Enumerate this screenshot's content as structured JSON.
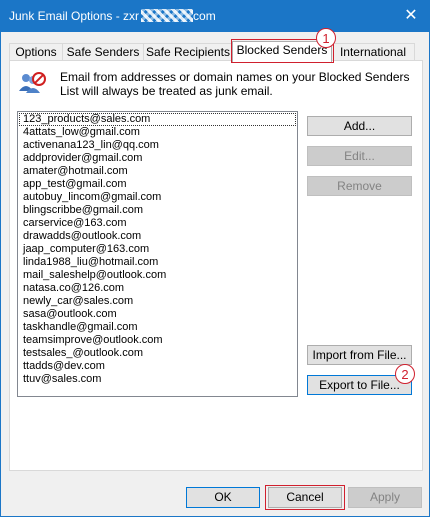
{
  "window": {
    "title_prefix": "Junk Email Options - zxr",
    "title_suffix": "com",
    "close_glyph": "✕"
  },
  "tabs": [
    {
      "label": "Options"
    },
    {
      "label": "Safe Senders"
    },
    {
      "label": "Safe Recipients"
    },
    {
      "label": "Blocked Senders"
    },
    {
      "label": "International"
    }
  ],
  "active_tab": "Blocked Senders",
  "annotations": [
    "1",
    "2"
  ],
  "info": {
    "icon": "blocked-senders-icon",
    "text": "Email from addresses or domain names on your Blocked Senders List will always be treated as junk email."
  },
  "senders": [
    "123_products@sales.com",
    "4attats_low@gmail.com",
    "activenana123_lin@qq.com",
    "addprovider@gmail.com",
    "amater@hotmail.com",
    "app_test@gmail.com",
    "autobuy_lincom@gmail.com",
    "blingscribbe@gmail.com",
    "carservice@163.com",
    "drawadds@outlook.com",
    "jaap_computer@163.com",
    "linda1988_liu@hotmail.com",
    "mail_saleshelp@outlook.com",
    "natasa.co@126.com",
    "newly_car@sales.com",
    "sasa@outlook.com",
    "taskhandle@gmail.com",
    "teamsimprove@outlook.com",
    "testsales_@outlook.com",
    "ttadds@dev.com",
    "ttuv@sales.com"
  ],
  "buttons": {
    "add": "Add...",
    "edit": "Edit...",
    "remove": "Remove",
    "import": "Import from File...",
    "export": "Export to File..."
  },
  "footer": {
    "ok": "OK",
    "cancel": "Cancel",
    "apply": "Apply"
  },
  "colors": {
    "titlebar": "#1b76c7",
    "annotation": "#d0202e"
  }
}
